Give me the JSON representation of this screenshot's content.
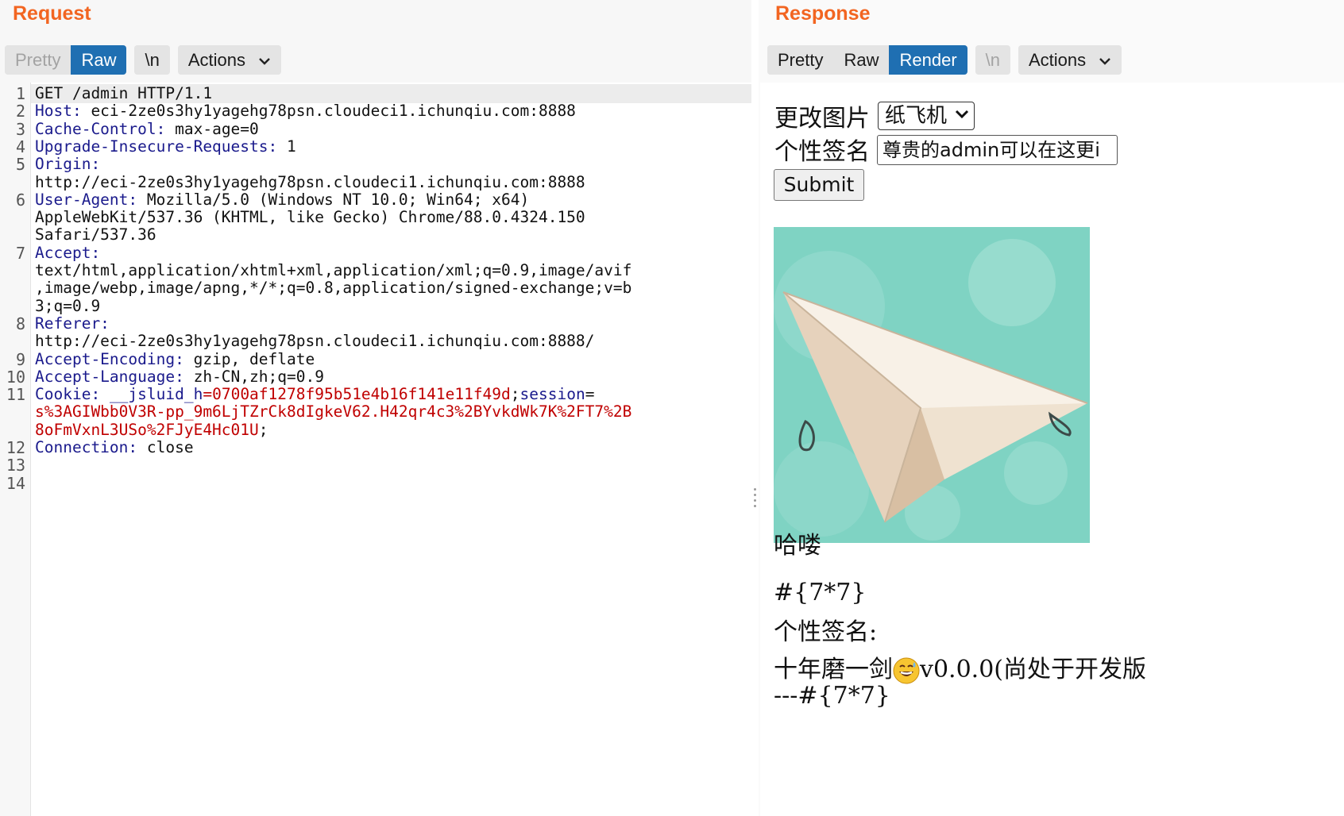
{
  "request": {
    "title": "Request",
    "tabs": [
      "Pretty",
      "Raw"
    ],
    "newline_label": "\\n",
    "actions_label": "Actions",
    "lines": [
      {
        "n": "1",
        "key": "",
        "value": "GET /admin HTTP/1.1"
      },
      {
        "n": "2",
        "key": "Host:",
        "value": " eci-2ze0s3hy1yagehg78psn.cloudeci1.ichunqiu.com:8888"
      },
      {
        "n": "3",
        "key": "Cache-Control:",
        "value": " max-age=0"
      },
      {
        "n": "4",
        "key": "Upgrade-Insecure-Requests:",
        "value": " 1"
      },
      {
        "n": "5",
        "key": "Origin:",
        "value": ""
      },
      {
        "n": "",
        "key": "",
        "value": "http://eci-2ze0s3hy1yagehg78psn.cloudeci1.ichunqiu.com:8888"
      },
      {
        "n": "6",
        "key": "User-Agent:",
        "value": " Mozilla/5.0 (Windows NT 10.0; Win64; x64)"
      },
      {
        "n": "",
        "key": "",
        "value": "AppleWebKit/537.36 (KHTML, like Gecko) Chrome/88.0.4324.150"
      },
      {
        "n": "",
        "key": "",
        "value": "Safari/537.36"
      },
      {
        "n": "7",
        "key": "Accept:",
        "value": ""
      },
      {
        "n": "",
        "key": "",
        "value": "text/html,application/xhtml+xml,application/xml;q=0.9,image/avif"
      },
      {
        "n": "",
        "key": "",
        "value": ",image/webp,image/apng,*/*;q=0.8,application/signed-exchange;v=b"
      },
      {
        "n": "",
        "key": "",
        "value": "3;q=0.9"
      },
      {
        "n": "8",
        "key": "Referer:",
        "value": ""
      },
      {
        "n": "",
        "key": "",
        "value": "http://eci-2ze0s3hy1yagehg78psn.cloudeci1.ichunqiu.com:8888/"
      },
      {
        "n": "9",
        "key": "Accept-Encoding:",
        "value": " gzip, deflate"
      },
      {
        "n": "10",
        "key": "Accept-Language:",
        "value": " zh-CN,zh;q=0.9"
      },
      {
        "n": "11",
        "key": "Cookie:",
        "value": ""
      },
      {
        "n": "",
        "key": "",
        "value": ""
      },
      {
        "n": "",
        "key": "",
        "value": ""
      },
      {
        "n": "12",
        "key": "Connection:",
        "value": " close"
      },
      {
        "n": "13",
        "key": "",
        "value": ""
      },
      {
        "n": "14",
        "key": "",
        "value": ""
      }
    ],
    "cookie": {
      "name1": "__jsluid_h",
      "value1": "0700af1278f95b51e4b16f141e11f49d",
      "name2": "session",
      "value2_line1": "s%3AGIWbb0V3R-pp_9m6LjTZrCk8dIgkeV62.H42qr4c3%2BYvkdWk7K%2FT7%2B",
      "value2_line2": "8oFmVxnL3USo%2FJyE4Hc01U"
    }
  },
  "response": {
    "title": "Response",
    "tabs": [
      "Pretty",
      "Raw",
      "Render"
    ],
    "newline_label": "\\n",
    "actions_label": "Actions",
    "render": {
      "image_label": "更改图片",
      "image_select_value": "纸飞机",
      "signature_label": "个性签名",
      "signature_input_value": "尊贵的admin可以在这更i",
      "submit_label": "Submit",
      "greeting": "哈喽",
      "template_expr": "#{7*7}",
      "signature_heading": "个性签名:",
      "signature_text_before": "十年磨一剑",
      "signature_text_after": "v0.0.0(尚处于开发版",
      "signature_footer": "---#{7*7}"
    },
    "colors": {
      "accent": "#f26521",
      "active_tab": "#1f6fb2",
      "plane_bg": "#7fd3c3"
    }
  }
}
